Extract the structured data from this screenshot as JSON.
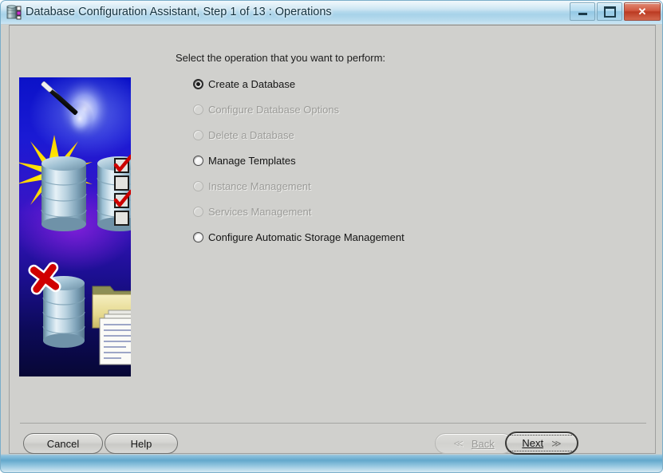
{
  "window": {
    "title": "Database Configuration Assistant, Step 1 of 13 : Operations",
    "icon": "database-app-icon",
    "caption_buttons": {
      "minimize": "minimize-icon",
      "maximize": "maximize-icon",
      "close_glyph": "✕"
    },
    "colors": {
      "titlebar_glass": "#bfdff0",
      "client_background": "#d0d0cd",
      "close_button": "#c24a30",
      "banner_blue": "#1a1ad4",
      "banner_purple": "#8a21de",
      "checkmark_red": "#cc0000",
      "star_yellow": "#ffe400"
    }
  },
  "main": {
    "prompt": "Select the operation that you want to perform:",
    "options": [
      {
        "label": "Create a Database",
        "selected": true,
        "enabled": true
      },
      {
        "label": "Configure Database Options",
        "selected": false,
        "enabled": false
      },
      {
        "label": "Delete a Database",
        "selected": false,
        "enabled": false
      },
      {
        "label": "Manage Templates",
        "selected": false,
        "enabled": true
      },
      {
        "label": "Instance Management",
        "selected": false,
        "enabled": false
      },
      {
        "label": "Services Management",
        "selected": false,
        "enabled": false
      },
      {
        "label": "Configure Automatic Storage Management",
        "selected": false,
        "enabled": true
      }
    ]
  },
  "banner": {
    "alt": "Database Configuration Assistant illustration: magic wand with starburst, database cylinders, checklist, red X and document folder"
  },
  "footer": {
    "cancel": "Cancel",
    "help": "Help",
    "back": {
      "label": "Back",
      "mnemonic": "B",
      "enabled": false,
      "chevron": "≪"
    },
    "next": {
      "label": "Next",
      "mnemonic": "N",
      "enabled": true,
      "focused": true,
      "chevron": "≫"
    }
  }
}
